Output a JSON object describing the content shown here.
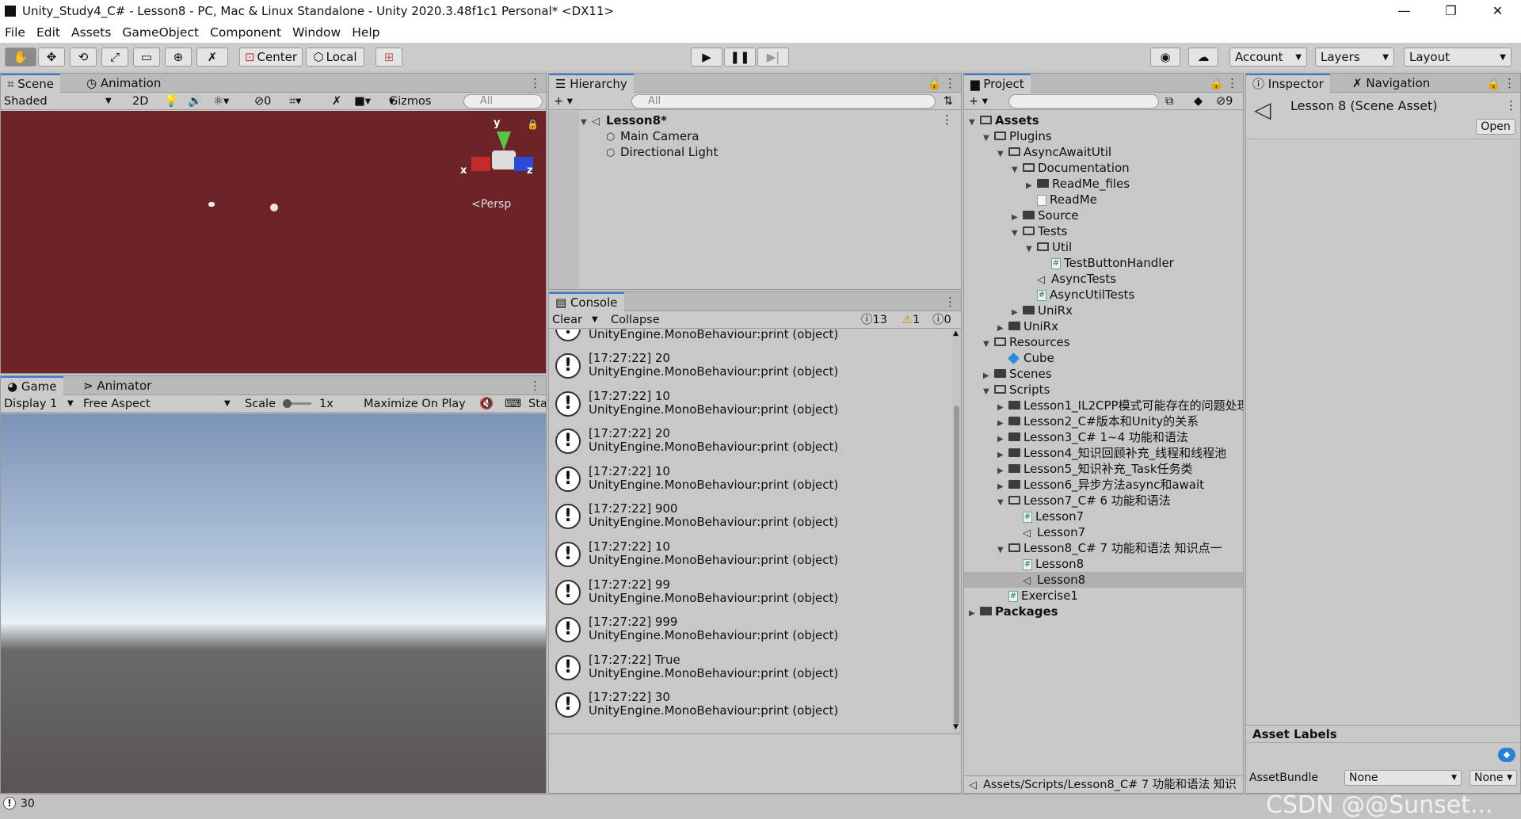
{
  "window": {
    "title": "Unity_Study4_C# - Lesson8 - PC, Mac & Linux Standalone - Unity 2020.3.48f1c1 Personal* <DX11>",
    "min": "—",
    "max": "❐",
    "close": "✕"
  },
  "menu": [
    "File",
    "Edit",
    "Assets",
    "GameObject",
    "Component",
    "Window",
    "Help"
  ],
  "toolbar": {
    "center": "Center",
    "local": "Local",
    "account": "Account",
    "layers": "Layers",
    "layout": "Layout"
  },
  "scene": {
    "tab": "Scene",
    "tab2": "Animation",
    "shading": "Shaded",
    "mode2d": "2D",
    "hidden": "0",
    "gizmos": "Gizmos",
    "search": "All",
    "persp": "Persp",
    "axis_x": "x",
    "axis_y": "y",
    "axis_z": "z"
  },
  "game": {
    "tab": "Game",
    "tab2": "Animator",
    "display": "Display 1",
    "aspect": "Free Aspect",
    "scale_label": "Scale",
    "scale_value": "1x",
    "maximize": "Maximize On Play",
    "stats": "Sta"
  },
  "hierarchy": {
    "tab": "Hierarchy",
    "search": "All",
    "scene": "Lesson8*",
    "items": [
      "Main Camera",
      "Directional Light"
    ]
  },
  "console": {
    "tab": "Console",
    "clear": "Clear",
    "collapse": "Collapse",
    "info_count": "13",
    "warn_count": "1",
    "error_count": "0",
    "partial": "UnityEngine.MonoBehaviour:print (object)",
    "logs": [
      {
        "msg": "[17:27:22] 20",
        "src": "UnityEngine.MonoBehaviour:print (object)"
      },
      {
        "msg": "[17:27:22] 10",
        "src": "UnityEngine.MonoBehaviour:print (object)"
      },
      {
        "msg": "[17:27:22] 20",
        "src": "UnityEngine.MonoBehaviour:print (object)"
      },
      {
        "msg": "[17:27:22] 10",
        "src": "UnityEngine.MonoBehaviour:print (object)"
      },
      {
        "msg": "[17:27:22] 900",
        "src": "UnityEngine.MonoBehaviour:print (object)"
      },
      {
        "msg": "[17:27:22] 10",
        "src": "UnityEngine.MonoBehaviour:print (object)"
      },
      {
        "msg": "[17:27:22] 99",
        "src": "UnityEngine.MonoBehaviour:print (object)"
      },
      {
        "msg": "[17:27:22] 999",
        "src": "UnityEngine.MonoBehaviour:print (object)"
      },
      {
        "msg": "[17:27:22] True",
        "src": "UnityEngine.MonoBehaviour:print (object)"
      },
      {
        "msg": "[17:27:22] 30",
        "src": "UnityEngine.MonoBehaviour:print (object)"
      }
    ]
  },
  "project": {
    "tab": "Project",
    "hidden": "9",
    "path": "Assets/Scripts/Lesson8_C# 7 功能和语法 知识",
    "tree": [
      {
        "d": 0,
        "t": "open",
        "i": "folder",
        "label": "Assets",
        "bold": true
      },
      {
        "d": 1,
        "t": "open",
        "i": "folder",
        "label": "Plugins"
      },
      {
        "d": 2,
        "t": "open",
        "i": "folder",
        "label": "AsyncAwaitUtil"
      },
      {
        "d": 3,
        "t": "open",
        "i": "folder",
        "label": "Documentation"
      },
      {
        "d": 4,
        "t": "closed",
        "i": "folder",
        "label": "ReadMe_files"
      },
      {
        "d": 4,
        "t": "none",
        "i": "doc",
        "label": "ReadMe"
      },
      {
        "d": 3,
        "t": "closed",
        "i": "folder",
        "label": "Source"
      },
      {
        "d": 3,
        "t": "open",
        "i": "folder",
        "label": "Tests"
      },
      {
        "d": 4,
        "t": "open",
        "i": "folder",
        "label": "Util"
      },
      {
        "d": 5,
        "t": "none",
        "i": "cs",
        "label": "TestButtonHandler"
      },
      {
        "d": 4,
        "t": "none",
        "i": "scene",
        "label": "AsyncTests"
      },
      {
        "d": 4,
        "t": "none",
        "i": "cs",
        "label": "AsyncUtilTests"
      },
      {
        "d": 3,
        "t": "closed",
        "i": "folder",
        "label": "UniRx"
      },
      {
        "d": 2,
        "t": "closed",
        "i": "folder",
        "label": "UniRx"
      },
      {
        "d": 1,
        "t": "open",
        "i": "folder",
        "label": "Resources"
      },
      {
        "d": 2,
        "t": "none",
        "i": "cube",
        "label": "Cube"
      },
      {
        "d": 1,
        "t": "closed",
        "i": "folder",
        "label": "Scenes"
      },
      {
        "d": 1,
        "t": "open",
        "i": "folder",
        "label": "Scripts"
      },
      {
        "d": 2,
        "t": "closed",
        "i": "folder",
        "label": "Lesson1_IL2CPP模式可能存在的问题处理"
      },
      {
        "d": 2,
        "t": "closed",
        "i": "folder",
        "label": "Lesson2_C#版本和Unity的关系"
      },
      {
        "d": 2,
        "t": "closed",
        "i": "folder",
        "label": "Lesson3_C# 1~4 功能和语法"
      },
      {
        "d": 2,
        "t": "closed",
        "i": "folder",
        "label": "Lesson4_知识回顾补充_线程和线程池"
      },
      {
        "d": 2,
        "t": "closed",
        "i": "folder",
        "label": "Lesson5_知识补充_Task任务类"
      },
      {
        "d": 2,
        "t": "closed",
        "i": "folder",
        "label": "Lesson6_异步方法async和await"
      },
      {
        "d": 2,
        "t": "open",
        "i": "folder",
        "label": "Lesson7_C# 6 功能和语法"
      },
      {
        "d": 3,
        "t": "none",
        "i": "cs",
        "label": "Lesson7"
      },
      {
        "d": 3,
        "t": "none",
        "i": "scene",
        "label": "Lesson7"
      },
      {
        "d": 2,
        "t": "open",
        "i": "folder",
        "label": "Lesson8_C# 7 功能和语法 知识点一"
      },
      {
        "d": 3,
        "t": "none",
        "i": "cs",
        "label": "Lesson8"
      },
      {
        "d": 3,
        "t": "none",
        "i": "scene",
        "label": "Lesson8",
        "selected": true
      },
      {
        "d": 2,
        "t": "none",
        "i": "cs",
        "label": "Exercise1"
      },
      {
        "d": 0,
        "t": "closed",
        "i": "folder",
        "label": "Packages",
        "bold": true
      }
    ]
  },
  "inspector": {
    "tab": "Inspector",
    "tab2": "Navigation",
    "asset_title": "Lesson 8 (Scene Asset)",
    "open": "Open",
    "labels_title": "Asset Labels",
    "bundle_label": "AssetBundle",
    "bundle_value": "None",
    "variant_value": "None"
  },
  "status": {
    "count": "30"
  },
  "watermark": "CSDN @@Sunset..."
}
